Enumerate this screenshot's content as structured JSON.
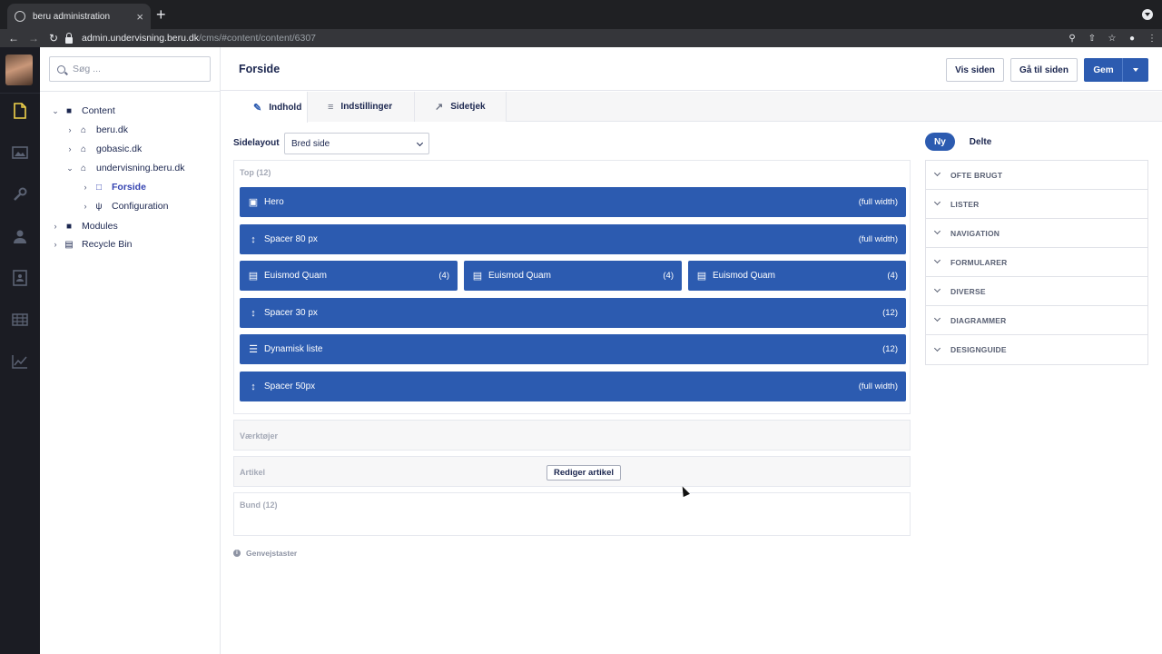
{
  "browser": {
    "tab_title": "beru administration",
    "tab_close": "×",
    "new_tab": "+",
    "url_host": "admin.undervisning.beru.dk",
    "url_path": "/cms/#content/content/6307"
  },
  "sidebar_rail": {
    "icons": [
      "content-icon",
      "media-icon",
      "tools-icon",
      "users-icon",
      "forms-icon",
      "tables-icon",
      "analytics-icon"
    ]
  },
  "tree": {
    "search_placeholder": "Søg ...",
    "nodes": [
      {
        "label": "Content",
        "icon": "folder-icon"
      },
      {
        "label": "beru.dk",
        "icon": "home-icon"
      },
      {
        "label": "gobasic.dk",
        "icon": "home-icon"
      },
      {
        "label": "undervisning.beru.dk",
        "icon": "home-icon"
      },
      {
        "label": "Forside",
        "icon": "page-icon"
      },
      {
        "label": "Configuration",
        "icon": "plug-icon"
      },
      {
        "label": "Modules",
        "icon": "folder-icon"
      },
      {
        "label": "Recycle Bin",
        "icon": "trash-icon"
      }
    ]
  },
  "header": {
    "title": "Forside",
    "view_page": "Vis siden",
    "goto_page": "Gå til siden",
    "save": "Gem"
  },
  "content_tabs": [
    {
      "label": "Indhold",
      "active": true
    },
    {
      "label": "Indstillinger",
      "active": false
    },
    {
      "label": "Sidetjek",
      "active": false
    }
  ],
  "layout": {
    "label": "Sidelayout",
    "selected": "Bred side"
  },
  "zones": {
    "top": {
      "label": "Top (12)",
      "blocks": [
        {
          "name": "Hero",
          "size": "(full width)",
          "icon": "image-icon"
        },
        {
          "name": "Spacer 80 px",
          "size": "(full width)",
          "icon": "spacer-icon"
        },
        {
          "name": "Euismod Quam",
          "size": "(4)",
          "icon": "document-icon"
        },
        {
          "name": "Euismod Quam",
          "size": "(4)",
          "icon": "document-icon"
        },
        {
          "name": "Euismod Quam",
          "size": "(4)",
          "icon": "document-icon"
        },
        {
          "name": "Spacer 30 px",
          "size": "(12)",
          "icon": "spacer-icon"
        },
        {
          "name": "Dynamisk liste",
          "size": "(12)",
          "icon": "list-icon"
        },
        {
          "name": "Spacer 50px",
          "size": "(full width)",
          "icon": "spacer-icon"
        }
      ]
    },
    "tools": {
      "label": "Værktøjer"
    },
    "article": {
      "label": "Artikel",
      "button": "Rediger artikel"
    },
    "bottom": {
      "label": "Bund (12)"
    }
  },
  "shortcuts": {
    "label": "Genvejstaster"
  },
  "library": {
    "pills": [
      {
        "label": "Ny",
        "active": true
      },
      {
        "label": "Delte",
        "active": false
      }
    ],
    "sections": [
      "OFTE BRUGT",
      "LISTER",
      "NAVIGATION",
      "FORMULARER",
      "DIVERSE",
      "DIAGRAMMER",
      "DESIGNGUIDE"
    ]
  },
  "colors": {
    "accent": "#2c5bb0",
    "rail": "#1b1c23",
    "active_rail_icon": "#f2d34b"
  }
}
